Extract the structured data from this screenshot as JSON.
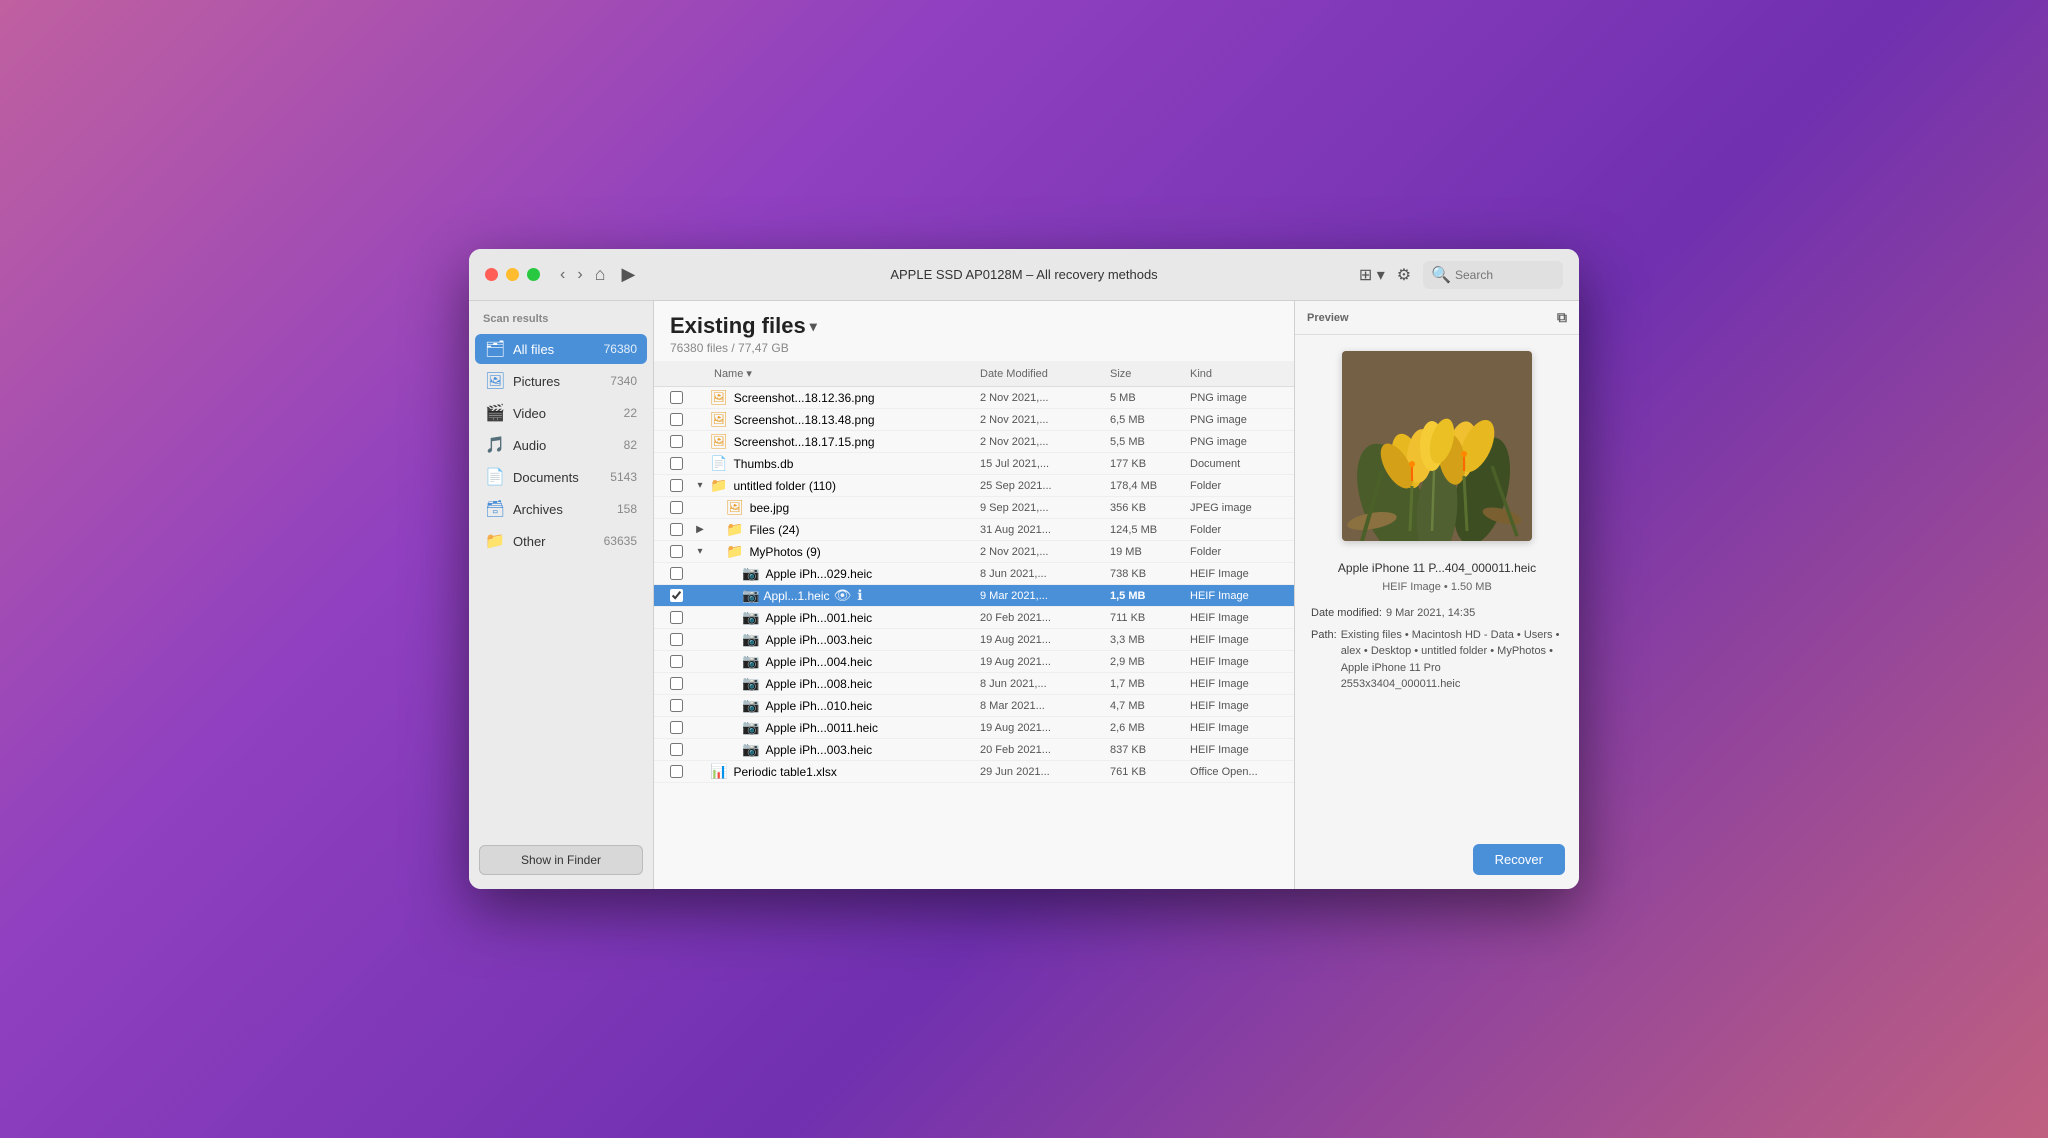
{
  "window": {
    "title": "APPLE SSD AP0128M – All recovery methods",
    "traffic_lights": [
      "red",
      "yellow",
      "green"
    ]
  },
  "titlebar": {
    "title": "APPLE SSD AP0128M – All recovery methods",
    "search_placeholder": "Search"
  },
  "sidebar": {
    "header": "Scan results",
    "items": [
      {
        "id": "all-files",
        "label": "All files",
        "count": "76380",
        "icon": "🗂",
        "active": true
      },
      {
        "id": "pictures",
        "label": "Pictures",
        "count": "7340",
        "icon": "🖼",
        "active": false
      },
      {
        "id": "video",
        "label": "Video",
        "count": "22",
        "icon": "🎬",
        "active": false
      },
      {
        "id": "audio",
        "label": "Audio",
        "count": "82",
        "icon": "🎵",
        "active": false
      },
      {
        "id": "documents",
        "label": "Documents",
        "count": "5143",
        "icon": "📄",
        "active": false
      },
      {
        "id": "archives",
        "label": "Archives",
        "count": "158",
        "icon": "🗃",
        "active": false
      },
      {
        "id": "other",
        "label": "Other",
        "count": "63635",
        "icon": "📁",
        "active": false
      }
    ],
    "show_finder_btn": "Show in Finder"
  },
  "file_list": {
    "title": "Existing files",
    "subtitle": "76380 files / 77,47 GB",
    "columns": [
      "Name",
      "Date Modified",
      "Size",
      "Kind"
    ],
    "rows": [
      {
        "id": 1,
        "name": "Screenshot...18.12.36.png",
        "date": "2 Nov 2021,...",
        "size": "5 MB",
        "kind": "PNG image",
        "type": "png",
        "indent": 0,
        "expandable": false,
        "checked": false,
        "selected": false
      },
      {
        "id": 2,
        "name": "Screenshot...18.13.48.png",
        "date": "2 Nov 2021,...",
        "size": "6,5 MB",
        "kind": "PNG image",
        "type": "png",
        "indent": 0,
        "expandable": false,
        "checked": false,
        "selected": false
      },
      {
        "id": 3,
        "name": "Screenshot...18.17.15.png",
        "date": "2 Nov 2021,...",
        "size": "5,5 MB",
        "kind": "PNG image",
        "type": "png",
        "indent": 0,
        "expandable": false,
        "checked": false,
        "selected": false
      },
      {
        "id": 4,
        "name": "Thumbs.db",
        "date": "15 Jul 2021,...",
        "size": "177 KB",
        "kind": "Document",
        "type": "doc",
        "indent": 0,
        "expandable": false,
        "checked": false,
        "selected": false
      },
      {
        "id": 5,
        "name": "untitled folder (110)",
        "date": "25 Sep 2021...",
        "size": "178,4 MB",
        "kind": "Folder",
        "type": "folder",
        "indent": 0,
        "expandable": true,
        "expanded": true,
        "checked": false,
        "selected": false
      },
      {
        "id": 6,
        "name": "bee.jpg",
        "date": "9 Sep 2021,...",
        "size": "356 KB",
        "kind": "JPEG image",
        "type": "jpg",
        "indent": 1,
        "expandable": false,
        "checked": false,
        "selected": false
      },
      {
        "id": 7,
        "name": "Files (24)",
        "date": "31 Aug 2021...",
        "size": "124,5 MB",
        "kind": "Folder",
        "type": "folder",
        "indent": 1,
        "expandable": true,
        "expanded": false,
        "checked": false,
        "selected": false
      },
      {
        "id": 8,
        "name": "MyPhotos (9)",
        "date": "2 Nov 2021,...",
        "size": "19 MB",
        "kind": "Folder",
        "type": "folder",
        "indent": 1,
        "expandable": true,
        "expanded": true,
        "checked": false,
        "selected": false
      },
      {
        "id": 9,
        "name": "Apple iPh...029.heic",
        "date": "8 Jun 2021,...",
        "size": "738 KB",
        "kind": "HEIF Image",
        "type": "heif",
        "indent": 2,
        "expandable": false,
        "checked": false,
        "selected": false
      },
      {
        "id": 10,
        "name": "Appl...1.heic",
        "date": "9 Mar 2021,...",
        "size": "1,5 MB",
        "kind": "HEIF Image",
        "type": "heif",
        "indent": 2,
        "expandable": false,
        "checked": true,
        "selected": true,
        "has_actions": true
      },
      {
        "id": 11,
        "name": "Apple iPh...001.heic",
        "date": "20 Feb 2021...",
        "size": "711 KB",
        "kind": "HEIF Image",
        "type": "heif",
        "indent": 2,
        "expandable": false,
        "checked": false,
        "selected": false
      },
      {
        "id": 12,
        "name": "Apple iPh...003.heic",
        "date": "19 Aug 2021...",
        "size": "3,3 MB",
        "kind": "HEIF Image",
        "type": "heif",
        "indent": 2,
        "expandable": false,
        "checked": false,
        "selected": false
      },
      {
        "id": 13,
        "name": "Apple iPh...004.heic",
        "date": "19 Aug 2021...",
        "size": "2,9 MB",
        "kind": "HEIF Image",
        "type": "heif",
        "indent": 2,
        "expandable": false,
        "checked": false,
        "selected": false
      },
      {
        "id": 14,
        "name": "Apple iPh...008.heic",
        "date": "8 Jun 2021,...",
        "size": "1,7 MB",
        "kind": "HEIF Image",
        "type": "heif",
        "indent": 2,
        "expandable": false,
        "checked": false,
        "selected": false
      },
      {
        "id": 15,
        "name": "Apple iPh...010.heic",
        "date": "8 Mar 2021...",
        "size": "4,7 MB",
        "kind": "HEIF Image",
        "type": "heif",
        "indent": 2,
        "expandable": false,
        "checked": false,
        "selected": false
      },
      {
        "id": 16,
        "name": "Apple iPh...0011.heic",
        "date": "19 Aug 2021...",
        "size": "2,6 MB",
        "kind": "HEIF Image",
        "type": "heif",
        "indent": 2,
        "expandable": false,
        "checked": false,
        "selected": false
      },
      {
        "id": 17,
        "name": "Apple iPh...003.heic",
        "date": "20 Feb 2021...",
        "size": "837 KB",
        "kind": "HEIF Image",
        "type": "heif",
        "indent": 2,
        "expandable": false,
        "checked": false,
        "selected": false
      },
      {
        "id": 18,
        "name": "Periodic table1.xlsx",
        "date": "29 Jun 2021...",
        "size": "761 KB",
        "kind": "Office Open...",
        "type": "xlsx",
        "indent": 0,
        "expandable": false,
        "checked": false,
        "selected": false
      }
    ]
  },
  "preview": {
    "header": "Preview",
    "filename": "Apple iPhone 11 P...404_000011.heic",
    "meta": "HEIF Image • 1.50 MB",
    "date_modified_label": "Date modified:",
    "date_modified": "9 Mar 2021, 14:35",
    "path_label": "Path:",
    "path": "Existing files • Macintosh HD - Data • Users • alex • Desktop • untitled folder • MyPhotos • Apple iPhone 11 Pro 2553x3404_000011.heic",
    "recover_label": "Recover"
  }
}
